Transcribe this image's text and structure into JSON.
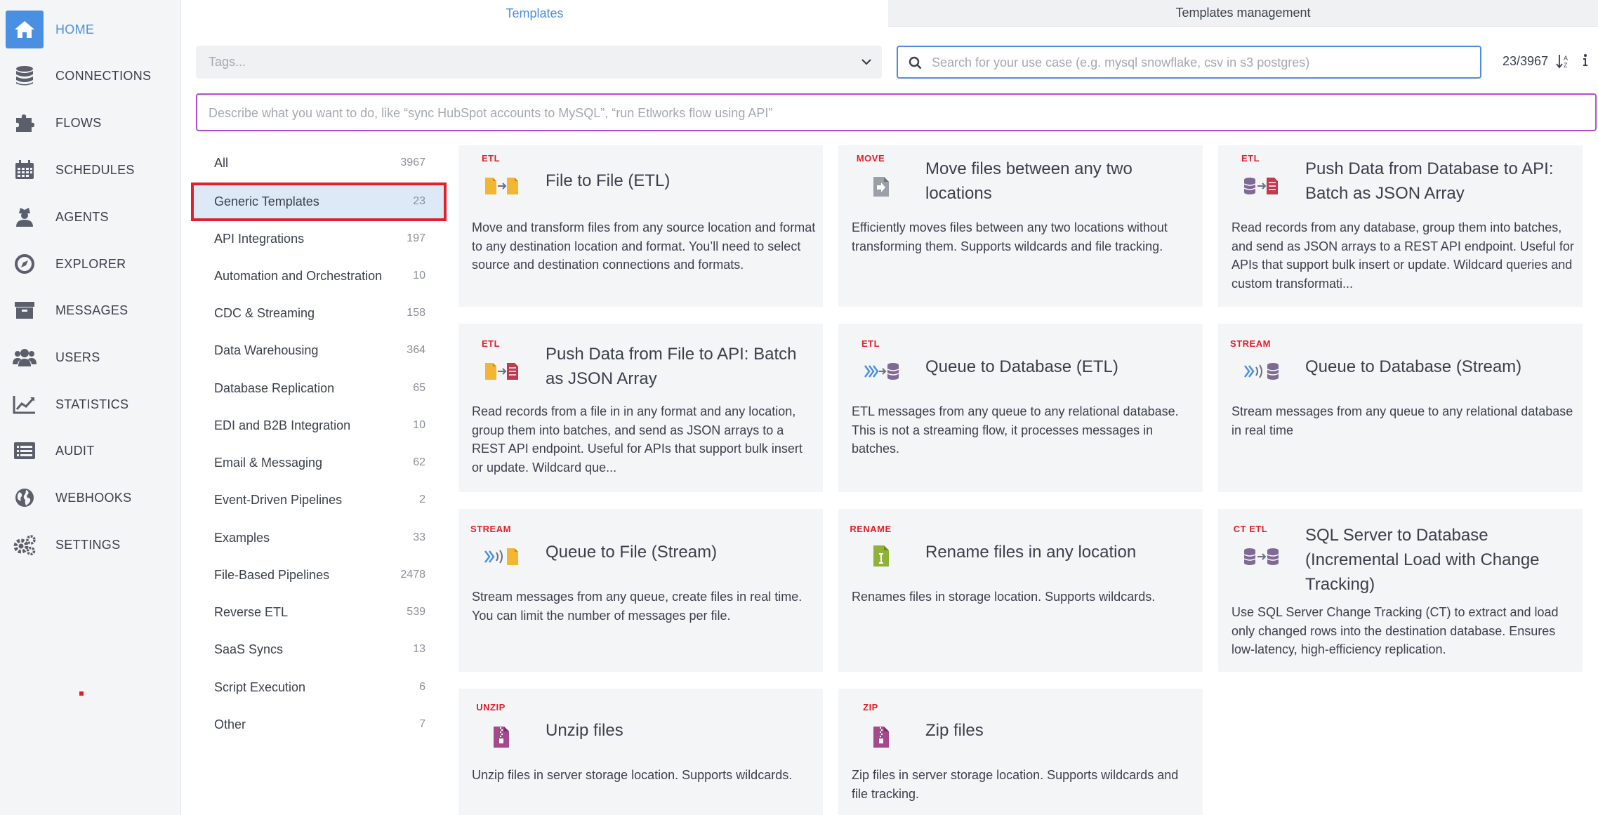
{
  "sidebar": {
    "items": [
      {
        "label": "HOME",
        "icon": "home-icon"
      },
      {
        "label": "CONNECTIONS",
        "icon": "database-icon"
      },
      {
        "label": "FLOWS",
        "icon": "puzzle-icon"
      },
      {
        "label": "SCHEDULES",
        "icon": "calendar-icon"
      },
      {
        "label": "AGENTS",
        "icon": "agent-icon"
      },
      {
        "label": "EXPLORER",
        "icon": "compass-icon"
      },
      {
        "label": "MESSAGES",
        "icon": "archive-icon"
      },
      {
        "label": "USERS",
        "icon": "users-icon"
      },
      {
        "label": "STATISTICS",
        "icon": "chart-icon"
      },
      {
        "label": "AUDIT",
        "icon": "list-icon"
      },
      {
        "label": "WEBHOOKS",
        "icon": "globe-icon"
      },
      {
        "label": "SETTINGS",
        "icon": "gears-icon"
      }
    ],
    "active": "HOME"
  },
  "tabs": {
    "templates": "Templates",
    "management": "Templates management"
  },
  "filters": {
    "tags_placeholder": "Tags...",
    "search_placeholder": "Search for your use case (e.g. mysql snowflake, csv in s3 postgres)",
    "count": "23/3967",
    "describe_placeholder": "Describe what you want to do, like “sync HubSpot accounts to MySQL”, “run Etlworks flow using API”"
  },
  "categories": [
    {
      "label": "All",
      "count": "3967"
    },
    {
      "label": "Generic Templates",
      "count": "23"
    },
    {
      "label": "API Integrations",
      "count": "197"
    },
    {
      "label": "Automation and Orchestration",
      "count": "10"
    },
    {
      "label": "CDC & Streaming",
      "count": "158"
    },
    {
      "label": "Data Warehousing",
      "count": "364"
    },
    {
      "label": "Database Replication",
      "count": "65"
    },
    {
      "label": "EDI and B2B Integration",
      "count": "10"
    },
    {
      "label": "Email & Messaging",
      "count": "62"
    },
    {
      "label": "Event-Driven Pipelines",
      "count": "2"
    },
    {
      "label": "Examples",
      "count": "33"
    },
    {
      "label": "File-Based Pipelines",
      "count": "2478"
    },
    {
      "label": "Reverse ETL",
      "count": "539"
    },
    {
      "label": "SaaS Syncs",
      "count": "13"
    },
    {
      "label": "Script Execution",
      "count": "6"
    },
    {
      "label": "Other",
      "count": "7"
    }
  ],
  "selected_category": "Generic Templates",
  "templates": [
    {
      "tag": "ETL",
      "icon": "file-to-file-icon",
      "title": "File to File (ETL)",
      "description": "Move and transform files from any source location and format to any destination location and format. You’ll need to select source and destination connections and formats."
    },
    {
      "tag": "MOVE",
      "icon": "move-file-icon",
      "title": "Move files between any two locations",
      "description": "Efficiently moves files between any two locations without transforming them. Supports wildcards and file tracking."
    },
    {
      "tag": "ETL",
      "icon": "database-to-api-icon",
      "title": "Push Data from Database to API: Batch as JSON Array",
      "description": "Read records from any database, group them into batches, and send as JSON arrays to a REST API endpoint. Useful for APIs that support bulk insert or update. Wildcard queries and custom transformati..."
    },
    {
      "tag": "ETL",
      "icon": "file-to-api-icon",
      "title": "Push Data from File to API: Batch as JSON Array",
      "description": "Read records from a file in in any format and any location, group them into batches, and send as JSON arrays to a REST API endpoint. Useful for APIs that support bulk insert or update. Wildcard que..."
    },
    {
      "tag": "ETL",
      "icon": "queue-to-database-icon",
      "title": "Queue to Database (ETL)",
      "description": "ETL messages from any queue to any relational database. This is not a streaming flow, it processes messages in batches."
    },
    {
      "tag": "STREAM",
      "icon": "stream-to-database-icon",
      "title": "Queue to Database (Stream)",
      "description": "Stream messages from any queue to any relational database in real time"
    },
    {
      "tag": "STREAM",
      "icon": "queue-to-file-icon",
      "title": "Queue to File (Stream)",
      "description": "Stream messages from any queue, create files in real time. You can limit the number of messages per file."
    },
    {
      "tag": "RENAME",
      "icon": "rename-file-icon",
      "title": "Rename files in any location",
      "description": "Renames files in storage location. Supports wildcards."
    },
    {
      "tag": "CT ETL",
      "icon": "database-to-database-icon",
      "title": "SQL Server to Database (Incremental Load with Change Tracking)",
      "description": "Use SQL Server Change Tracking (CT) to extract and load only changed rows into the destination database. Ensures low-latency, high-efficiency replication."
    },
    {
      "tag": "UNZIP",
      "icon": "zip-file-icon",
      "title": "Unzip files",
      "description": "Unzip files in server storage location. Supports wildcards."
    },
    {
      "tag": "ZIP",
      "icon": "zip-file-icon",
      "title": "Zip files",
      "description": "Zip files in server storage location. Supports wildcards and file tracking."
    }
  ],
  "colors": {
    "accent": "#4a90e2",
    "tag_red": "#e0202a",
    "selection_outline": "#e0202a",
    "describe_border": "#b34dcc",
    "file_yellow": "#f2b632",
    "db_purple": "#7f6a93"
  }
}
